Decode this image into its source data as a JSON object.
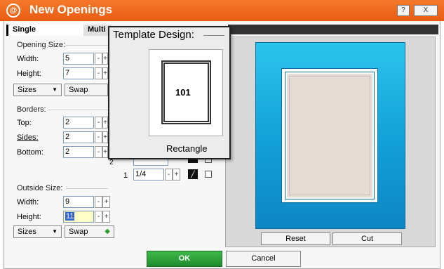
{
  "window": {
    "title": "New Openings",
    "help_label": "?",
    "close_label": "X"
  },
  "tabs": [
    {
      "label": "Single",
      "active": true
    },
    {
      "label": "Multi",
      "active": false
    }
  ],
  "opening_size": {
    "section_label": "Opening Size:",
    "width_label": "Width:",
    "width_value": "5",
    "height_label": "Height:",
    "height_value": "7",
    "sizes_label": "Sizes",
    "swap_label": "Swap"
  },
  "borders": {
    "section_label": "Borders:",
    "top_label": "Top:",
    "top_value": "2",
    "sides_label": "Sides:",
    "sides_value": "2",
    "bottom_label": "Bottom:",
    "bottom_value": "2"
  },
  "layers": {
    "row_number": "1",
    "row_value": "1/4"
  },
  "outside_size": {
    "section_label": "Outside Size:",
    "width_label": "Width:",
    "width_value": "9",
    "height_label": "Height:",
    "height_value": "11",
    "sizes_label": "Sizes",
    "swap_label": "Swap"
  },
  "stepper": {
    "minus": "-",
    "plus": "+"
  },
  "template_popup": {
    "title": "Template Design:",
    "template_number": "101",
    "template_name": "Rectangle"
  },
  "preview": {
    "mat_color": "#129fd6",
    "reset_label": "Reset",
    "cut_label": "Cut"
  },
  "footer": {
    "ok_label": "OK",
    "cancel_label": "Cancel"
  },
  "colors": {
    "titlebar": "#e95c12",
    "ok_button": "#1f8a2b"
  }
}
